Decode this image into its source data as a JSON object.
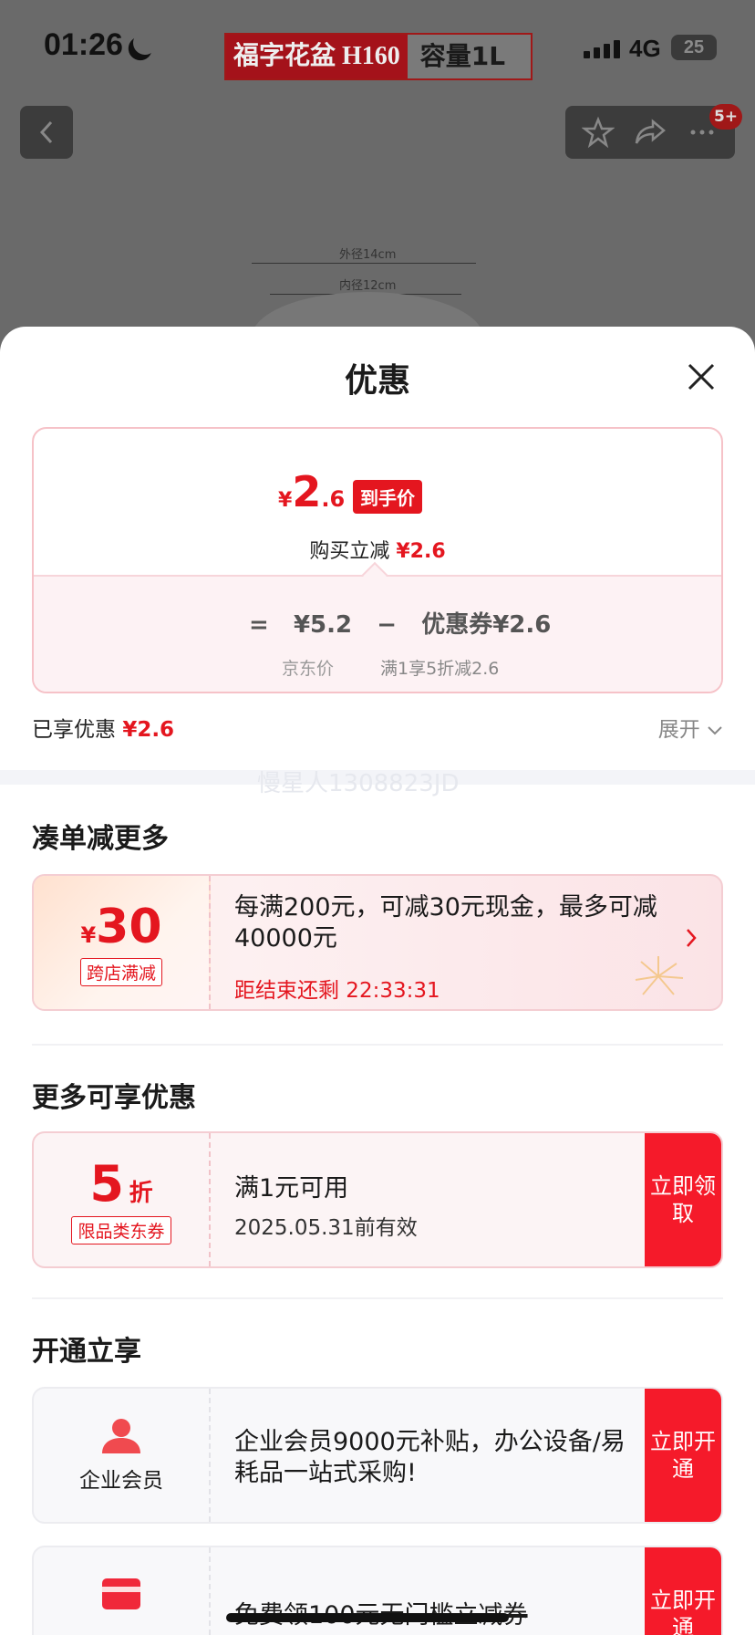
{
  "status_bar": {
    "time": "01:26",
    "network": "4G",
    "battery": "25"
  },
  "product_banner": {
    "name": "福字花盆",
    "size": "H160",
    "capacity": "容量1L"
  },
  "notification_badge": "5+",
  "diagram": {
    "outer": "外径14cm",
    "inner": "内径12cm"
  },
  "sheet": {
    "title": "优惠",
    "price_card": {
      "currency": "¥",
      "final_int": "2",
      "final_dec": ".6",
      "final_tag": "到手价",
      "save_label": "购买立减",
      "save_amount": "¥2.6",
      "eq_sign": "=",
      "jd_price": "¥5.2",
      "minus_sign": "−",
      "coupon_label": "优惠券¥2.6",
      "jd_price_label": "京东价",
      "coupon_rule": "满1享5折减2.6"
    },
    "enjoyed": {
      "label": "已享优惠",
      "amount": "¥2.6",
      "expand": "展开"
    },
    "watermark": "慢星人1308823JD",
    "section_more": "凑单减更多",
    "cross_store": {
      "currency": "¥",
      "amount": "30",
      "tag": "跨店满减",
      "desc": "每满200元，可减30元现金，最多可减40000元",
      "timer": "距结束还剩 22:33:31"
    },
    "section_more_discounts": "更多可享优惠",
    "coupon": {
      "amount": "5",
      "unit": "折",
      "tag": "限品类东券",
      "line1": "满1元可用",
      "line2": "2025.05.31前有效",
      "cta": "立即领取"
    },
    "section_open": "开通立享",
    "enterprise": {
      "label": "企业会员",
      "desc": "企业会员9000元补贴，办公设备/易耗品一站式采购!",
      "cta": "立即开通"
    },
    "card_offer": {
      "desc": "免费领100元无门槛立减券",
      "cta": "立即开通"
    }
  },
  "colors": {
    "accent": "#e4161f",
    "cta": "#f51a2a"
  }
}
